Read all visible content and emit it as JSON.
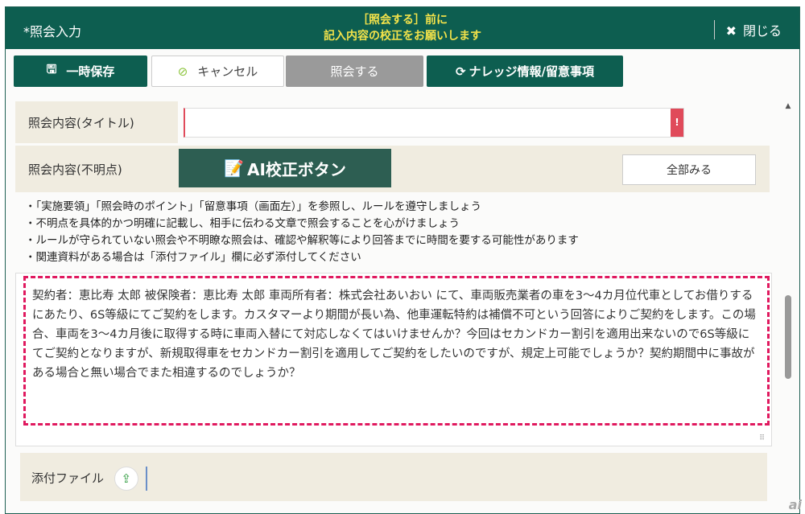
{
  "header": {
    "title": "*照会入力",
    "notice_line1": "［照会する］前に",
    "notice_line2": "記入内容の校正をお願いします",
    "close": "閉じる"
  },
  "toolbar": {
    "save": "一時保存",
    "cancel": "キャンセル",
    "submit": "照会する",
    "knowledge": "ナレッジ情報/留意事項"
  },
  "form": {
    "title_label": "照会内容(タイトル)",
    "title_value": "",
    "error_mark": "!",
    "detail_label": "照会内容(不明点)",
    "ai_button": "AI校正ボタン",
    "show_all": "全部みる",
    "bullets": [
      "・「実施要領」「照会時のポイント」「留意事項（画面左）」を参照し、ルールを遵守しましょう",
      "・不明点を具体的かつ明確に記載し、相手に伝わる文章で照会することを心がけましょう",
      "・ルールが守られていない照会や不明瞭な照会は、確認や解釈等により回答までに時間を要する可能性があります",
      "・関連資料がある場合は「添付ファイル」欄に必ず添付してください"
    ],
    "detail_value": "契約者：恵比寿 太郎 被保険者：恵比寿 太郎 車両所有者：株式会社あいおい にて、車両販売業者の車を3～4カ月位代車としてお借りするにあたり、6S等級にてご契約をします。カスタマーより期間が長い為、他車運転特約は補償不可という回答によりご契約をします。この場合、車両を3～4カ月後に取得する時に車両入替にて対応しなくてはいけませんか？今回はセカンドカー割引を適用出来ないので6S等級にてご契約となりますが、新規取得車をセカンドカー割引を適用してご契約をしたいのですが、規定上可能でしょうか？契約期間中に事故がある場合と無い場合でまた相違するのでしょうか？",
    "attachment_label": "添付ファイル"
  },
  "watermark": "ai"
}
